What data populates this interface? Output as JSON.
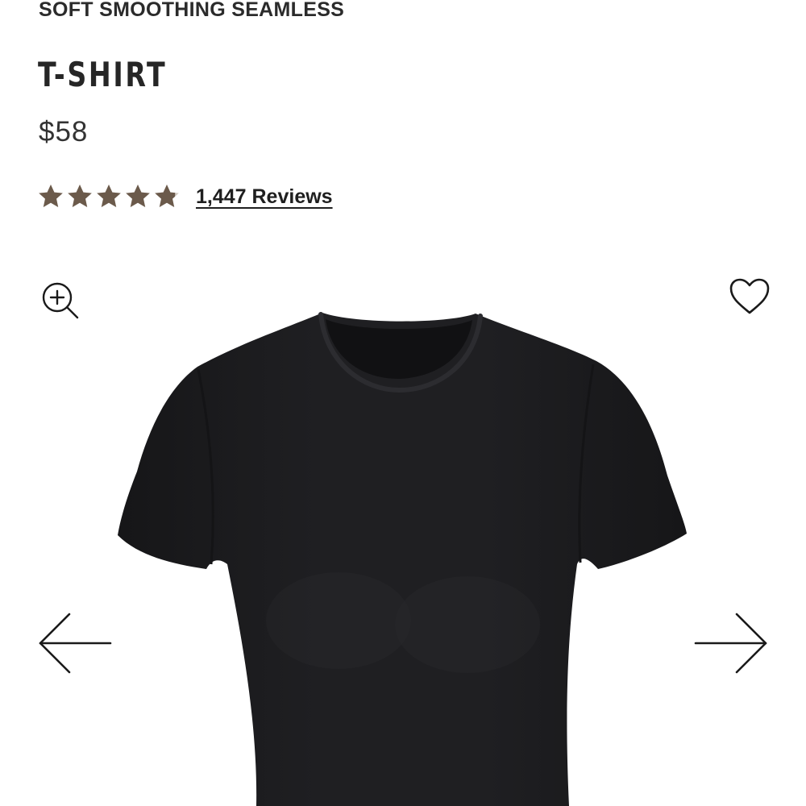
{
  "product": {
    "collection": "SOFT SMOOTHING SEAMLESS",
    "title": "T-SHIRT",
    "price": "$58",
    "rating": 4.8,
    "rating_max": 5,
    "reviews_label": "1,447 Reviews"
  },
  "gallery": {
    "image_subject": "black short-sleeve t-shirt",
    "zoom_icon": "zoom-in-icon",
    "wishlist_icon": "heart-outline-icon",
    "prev_icon": "arrow-left-icon",
    "next_icon": "arrow-right-icon"
  },
  "colors": {
    "star": "#6b5a4b",
    "text": "#1a1a1a",
    "garment": "#1c1c1e",
    "background": "#ffffff"
  }
}
